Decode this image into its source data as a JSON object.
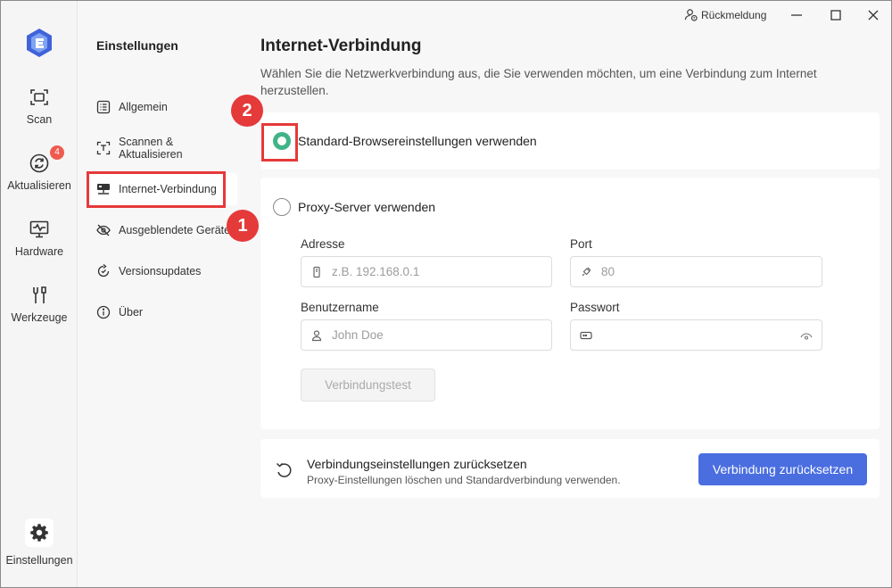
{
  "titlebar": {
    "feedback_label": "Rückmeldung"
  },
  "rail": {
    "items": [
      {
        "label": "Scan",
        "icon": "scan-icon"
      },
      {
        "label": "Aktualisieren",
        "icon": "refresh-icon",
        "badge": "4"
      },
      {
        "label": "Hardware",
        "icon": "monitor-icon"
      },
      {
        "label": "Werkzeuge",
        "icon": "tools-icon"
      }
    ],
    "settings_label": "Einstellungen"
  },
  "nav": {
    "title": "Einstellungen",
    "items": [
      {
        "label": "Allgemein",
        "icon": "list-icon"
      },
      {
        "label": "Scannen & Aktualisieren",
        "icon": "text-scan-icon"
      },
      {
        "label": "Internet-Verbindung",
        "icon": "network-icon"
      },
      {
        "label": "Ausgeblendete Geräte",
        "icon": "eye-off-icon"
      },
      {
        "label": "Versionsupdates",
        "icon": "update-icon"
      },
      {
        "label": "Über",
        "icon": "info-icon"
      }
    ]
  },
  "annotations": {
    "step1": "1",
    "step2": "2"
  },
  "main": {
    "title": "Internet-Verbindung",
    "description": "Wählen Sie die Netzwerkverbindung aus, die Sie verwenden möchten, um eine Verbindung zum Internet herzustellen.",
    "option_default": "Standard-Browsereinstellungen verwenden",
    "option_proxy": "Proxy-Server verwenden",
    "fields": {
      "address_label": "Adresse",
      "address_placeholder": "z.B. 192.168.0.1",
      "port_label": "Port",
      "port_placeholder": "80",
      "username_label": "Benutzername",
      "username_placeholder": "John Doe",
      "password_label": "Passwort",
      "password_placeholder": ""
    },
    "test_button": "Verbindungstest",
    "reset": {
      "title": "Verbindungseinstellungen zurücksetzen",
      "subtitle": "Proxy-Einstellungen löschen und Standardverbindung verwenden.",
      "button": "Verbindung zurücksetzen"
    }
  },
  "colors": {
    "accent": "#4a6ee0",
    "radio_selected": "#3fb487",
    "annotation_red": "#e53a3a",
    "badge": "#ef5a4f"
  }
}
